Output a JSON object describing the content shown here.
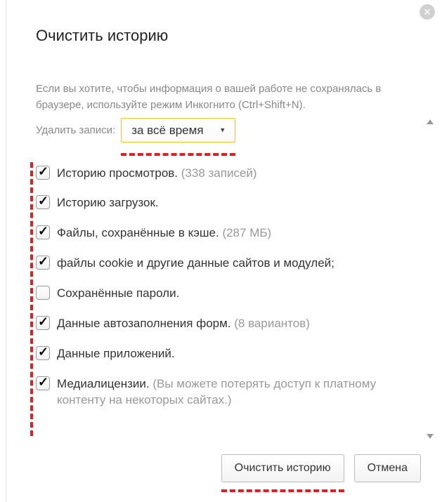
{
  "dialog": {
    "title": "Очистить историю",
    "intro": "Если вы хотите, чтобы информация о вашей работе не сохранялась в браузере, используйте режим Инкогнито (Ctrl+Shift+N).",
    "delete_label": "Удалить записи:",
    "select_value": "за всё время",
    "items": [
      {
        "checked": true,
        "label": "Историю просмотров.",
        "extra": " (338 записей)"
      },
      {
        "checked": true,
        "label": "Историю загрузок.",
        "extra": ""
      },
      {
        "checked": true,
        "label": "Файлы, сохранённые в кэше.",
        "extra": " (287 МБ)"
      },
      {
        "checked": true,
        "label": "файлы cookie и другие данные сайтов и модулей;",
        "extra": ""
      },
      {
        "checked": false,
        "label": "Сохранённые пароли.",
        "extra": ""
      },
      {
        "checked": true,
        "label": "Данные автозаполнения форм.",
        "extra": " (8 вариантов)"
      },
      {
        "checked": true,
        "label": "Данные приложений.",
        "extra": ""
      },
      {
        "checked": true,
        "label": "Медиалицензии.",
        "extra": " (Вы можете потерять доступ к платному контенту на некоторых сайтах.)"
      }
    ],
    "buttons": {
      "clear": "Очистить историю",
      "cancel": "Отмена"
    }
  }
}
